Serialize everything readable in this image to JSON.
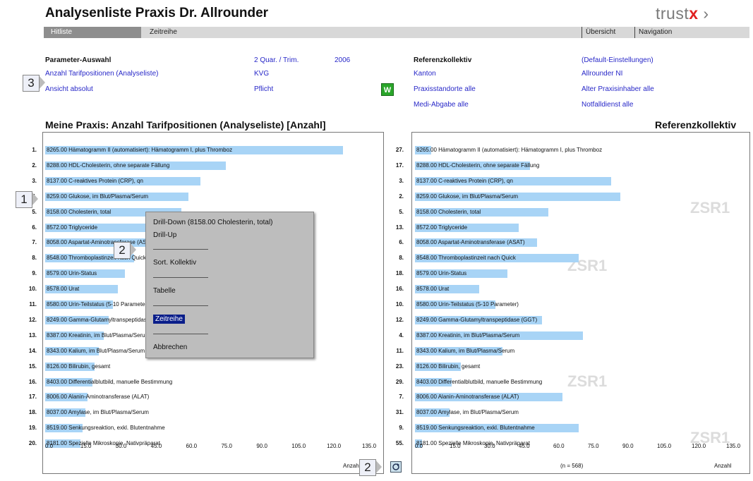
{
  "header": {
    "title": "Analysenliste Praxis Dr. Allrounder",
    "brand_a": "trust",
    "brand_b": "x",
    "brand_c": " ›"
  },
  "nav": {
    "tab_active": "Hitliste",
    "tab2": "Zeitreihe",
    "right1": "Übersicht",
    "right2": "Navigation"
  },
  "params": {
    "heading": "Parameter-Auswahl",
    "row1": "Anzahl Tarifpositionen (Analyseliste)",
    "row2": "Ansicht absolut",
    "period": "2 Quar. / Trim.",
    "year": "2006",
    "kvg": "KVG",
    "pflicht": "Pflicht",
    "wbutton": "W",
    "ref_heading": "Referenzkollektiv",
    "ref_default": "(Default-Einstellungen)",
    "ref_kanton": "Kanton",
    "ref_kanton_val": "Allrounder NI",
    "ref_standorte": "Praxisstandorte alle",
    "ref_alter": "Alter Praxisinhaber alle",
    "ref_medi": "Medi-Abgabe alle",
    "ref_notfall": "Notfalldienst alle"
  },
  "markers": {
    "m1": "1",
    "m2": "2",
    "m3": "3",
    "m2b": "2"
  },
  "left_panel": {
    "title": "Meine Praxis: Anzahl Tarifpositionen (Analyseliste) [Anzahl]",
    "axis_label": "Anzahl",
    "ticks": [
      "0.0",
      "15.0",
      "30.0",
      "45.0",
      "60.0",
      "75.0",
      "90.0",
      "105.0",
      "120.0",
      "135.0"
    ]
  },
  "right_panel": {
    "title": "Referenzkollektiv",
    "axis_label": "Anzahl",
    "n_label": "(n = 568)",
    "watermark": "ZSR1",
    "ticks": [
      "0.0",
      "15.0",
      "30.0",
      "45.0",
      "60.0",
      "75.0",
      "90.0",
      "105.0",
      "120.0",
      "135.0"
    ]
  },
  "context_menu": {
    "item1": "Drill-Down (8158.00 Cholesterin, total)",
    "item2": "Drill-Up",
    "item3": "Sort. Kollektiv",
    "item4": "Tabelle",
    "item5": "Zeitreihe",
    "item6": "Abbrechen"
  },
  "chart_data": [
    {
      "type": "bar",
      "title": "Meine Praxis: Anzahl Tarifpositionen (Analyseliste) [Anzahl]",
      "xlabel": "Anzahl",
      "xlim": [
        0,
        135
      ],
      "ranks": [
        "1.",
        "2.",
        "3.",
        "4.",
        "5.",
        "6.",
        "7.",
        "8.",
        "9.",
        "10.",
        "11.",
        "12.",
        "13.",
        "14.",
        "15.",
        "16.",
        "17.",
        "18.",
        "19.",
        "20."
      ],
      "categories": [
        "8265.00 Hämatogramm II (automatisiert): Hämatogramm I, plus Thromboz",
        "8288.00 HDL-Cholesterin, ohne separate Fällung",
        "8137.00 C-reaktives Protein (CRP), qn",
        "8259.00 Glukose, im Blut/Plasma/Serum",
        "8158.00 Cholesterin, total",
        "8572.00 Triglyceride",
        "8058.00 Aspartat-Aminotransferase (ASAT)",
        "8548.00 Thromboplastinzeit nach Quick",
        "8579.00 Urin-Status",
        "8578.00 Urat",
        "8580.00 Urin-Teilstatus (5-10 Parameter)",
        "8249.00 Gamma-Glutamyltranspeptidase (GGT)",
        "8387.00 Kreatinin, im Blut/Plasma/Serum",
        "8343.00 Kalium, im Blut/Plasma/Serum",
        "8126.00 Bilirubin, gesamt",
        "8403.00 Differentialblutbild, manuelle Bestimmung",
        "8006.00 Alanin-Aminotransferase (ALAT)",
        "8037.00 Amylase, im Blut/Plasma/Serum",
        "8519.00 Senkungsreaktion, exkl. Blutentnahme",
        "8181.00 Spezielle Mikroskopie, Nativpräparat"
      ],
      "values": [
        127,
        77,
        66,
        61,
        58,
        49,
        44,
        38,
        34,
        31,
        29,
        27,
        25,
        23,
        21,
        20,
        18,
        17,
        16,
        15
      ]
    },
    {
      "type": "bar",
      "title": "Referenzkollektiv",
      "xlabel": "Anzahl",
      "xlim": [
        0,
        135
      ],
      "ranks": [
        "27.",
        "17.",
        "3.",
        "2.",
        "5.",
        "13.",
        "6.",
        "8.",
        "18.",
        "16.",
        "10.",
        "12.",
        "4.",
        "11.",
        "23.",
        "29.",
        "7.",
        "31.",
        "9.",
        "55."
      ],
      "categories": [
        "8265.00 Hämatogramm II (automatisiert): Hämatogramm I, plus Thromboz",
        "8288.00 HDL-Cholesterin, ohne separate Fällung",
        "8137.00 C-reaktives Protein (CRP), qn",
        "8259.00 Glukose, im Blut/Plasma/Serum",
        "8158.00 Cholesterin, total",
        "8572.00 Triglyceride",
        "8058.00 Aspartat-Aminotransferase (ASAT)",
        "8548.00 Thromboplastinzeit nach Quick",
        "8579.00 Urin-Status",
        "8578.00 Urat",
        "8580.00 Urin-Teilstatus (5-10 Parameter)",
        "8249.00 Gamma-Glutamyltranspeptidase (GGT)",
        "8387.00 Kreatinin, im Blut/Plasma/Serum",
        "8343.00 Kalium, im Blut/Plasma/Serum",
        "8126.00 Bilirubin, gesamt",
        "8403.00 Differentialblutbild, manuelle Bestimmung",
        "8006.00 Alanin-Aminotransferase (ALAT)",
        "8037.00 Amylase, im Blut/Plasma/Serum",
        "8519.00 Senkungsreaktion, exkl. Blutentnahme",
        "8181.00 Spezielle Mikroskopie, Nativpräparat"
      ],
      "values": [
        7,
        50,
        85,
        89,
        58,
        45,
        53,
        71,
        40,
        28,
        35,
        55,
        73,
        38,
        20,
        16,
        64,
        15,
        71,
        3
      ]
    }
  ]
}
